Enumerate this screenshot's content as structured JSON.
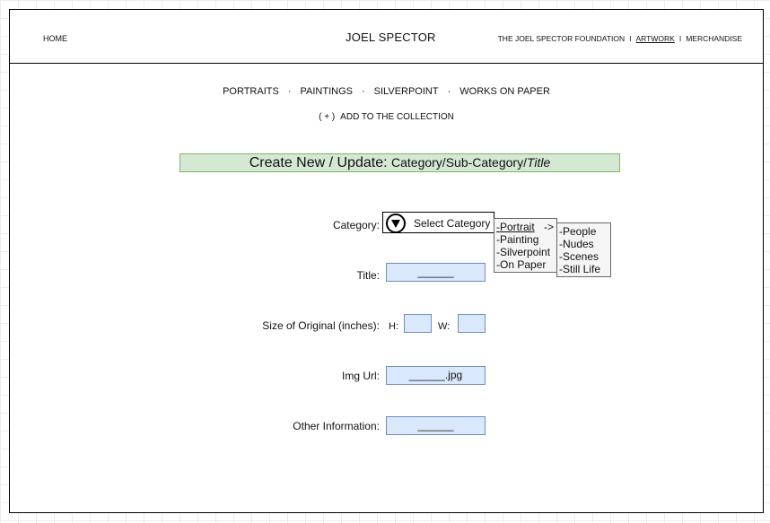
{
  "header": {
    "home_label": "HOME",
    "site_title": "JOEL SPECTOR",
    "nav": [
      {
        "label": "THE JOEL SPECTOR FOUNDATION",
        "active": false
      },
      {
        "label": "ARTWORK",
        "active": true
      },
      {
        "label": "MERCHANDISE",
        "active": false
      }
    ],
    "nav_separator": "I"
  },
  "category_nav": {
    "items": [
      "PORTRAITS",
      "PAINTINGS",
      "SILVERPOINT",
      "WORKS ON PAPER"
    ],
    "separator": "·"
  },
  "add_link": {
    "plus": "( + )",
    "label": "ADD TO THE COLLECTION"
  },
  "banner": {
    "lead": "Create New / Update:",
    "path": "Category/Sub-Category/",
    "italic": "Title",
    "color": "#d5e8d4"
  },
  "form": {
    "category": {
      "label": "Category:",
      "select_placeholder": "Select Category",
      "menu": [
        "-Portrait",
        "-Painting",
        "-Silverpoint",
        "-On Paper"
      ],
      "submenu_arrow": "->",
      "submenu": [
        "-People",
        "-Nudes",
        "-Scenes",
        "-Still Life"
      ]
    },
    "title": {
      "label": "Title:",
      "value": "______"
    },
    "size": {
      "label": "Size of Original (inches):",
      "h_label": "H:",
      "w_label": "W:",
      "h_value": "",
      "w_value": ""
    },
    "img_url": {
      "label": "Img Url:",
      "value": "______.jpg"
    },
    "other": {
      "label": "Other Information:",
      "value": "______"
    },
    "field_color": "#dae8fc"
  }
}
